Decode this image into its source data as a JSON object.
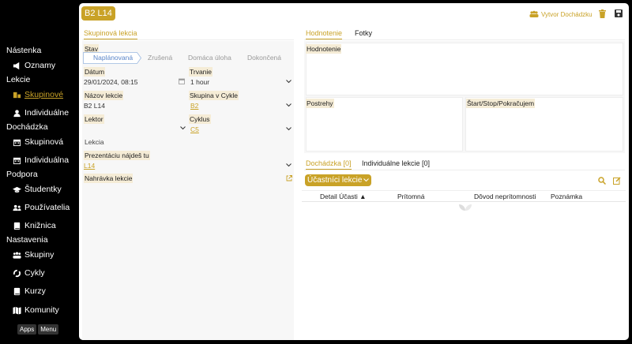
{
  "sidebar": {
    "sections": [
      {
        "label": "Nástenka",
        "items": [
          {
            "label": "Oznamy",
            "icon": "megaphone-icon"
          }
        ]
      },
      {
        "label": "Lekcie",
        "items": [
          {
            "label": "Skupinové",
            "icon": "group-lesson-icon",
            "active": true
          },
          {
            "label": "Individuálne",
            "icon": "user-icon"
          }
        ]
      },
      {
        "label": "Dochádzka",
        "items": [
          {
            "label": "Skupinová",
            "icon": "calendar-icon"
          },
          {
            "label": "Individuálna",
            "icon": "calendar-icon"
          }
        ]
      },
      {
        "label": "Podpora",
        "items": [
          {
            "label": "Študentky",
            "icon": "graduation-cap-icon"
          },
          {
            "label": "Používatelia",
            "icon": "users-icon"
          },
          {
            "label": "Knižnica",
            "icon": "book-icon"
          }
        ]
      },
      {
        "label": "Nastavenia",
        "items": [
          {
            "label": "Skupiny",
            "icon": "people-group-icon"
          },
          {
            "label": "Cykly",
            "icon": "cycle-icon"
          },
          {
            "label": "Kurzy",
            "icon": "book-icon"
          },
          {
            "label": "Komunity",
            "icon": "map-icon"
          }
        ]
      }
    ],
    "apps_label": "Apps",
    "menu_label": "Menu"
  },
  "header": {
    "title": "B2 L14",
    "create_attendance_label": "Vytvor Dochádzku"
  },
  "left_tab": "Skupinová lekcia",
  "status": {
    "label": "Stav",
    "steps": [
      "Naplánovaná",
      "Zrušená",
      "Domáca úloha",
      "Dokončená"
    ],
    "active": "Naplánovaná"
  },
  "fields": {
    "date_label": "Dátum",
    "date_value": "29/01/2024, 08:15",
    "duration_label": "Trvanie",
    "duration_value": "1 hour",
    "name_label": "Názov lekcie",
    "name_value": "B2 L14",
    "group_label": "Skupina v Cykle",
    "group_value": "B2",
    "lecturer_label": "Lektor",
    "lecturer_value": "",
    "cycle_label": "Cyklus",
    "cycle_value": "C5",
    "lesson_label": "Lekcia",
    "presentation_label": "Prezentáciu nájdeš tu",
    "presentation_value": "L14",
    "recording_label": "Nahrávka lekcie"
  },
  "right_tabs": [
    "Hodnotenie",
    "Fotky"
  ],
  "evaluation_label": "Hodnotenie",
  "needs_label": "Postrehy",
  "start_stop_label": "Štart/Stop/Pokračujem",
  "bottom_tabs": [
    "Dochádzka [0]",
    "Individuálne lekcie [0]"
  ],
  "participants_label": "Účastníci lekcie",
  "table_headers": [
    "Detail Účasti ▲",
    "Prítomná",
    "Dôvod neprítomnosti",
    "Poznámka"
  ],
  "colors": {
    "accent": "#c9a227"
  }
}
